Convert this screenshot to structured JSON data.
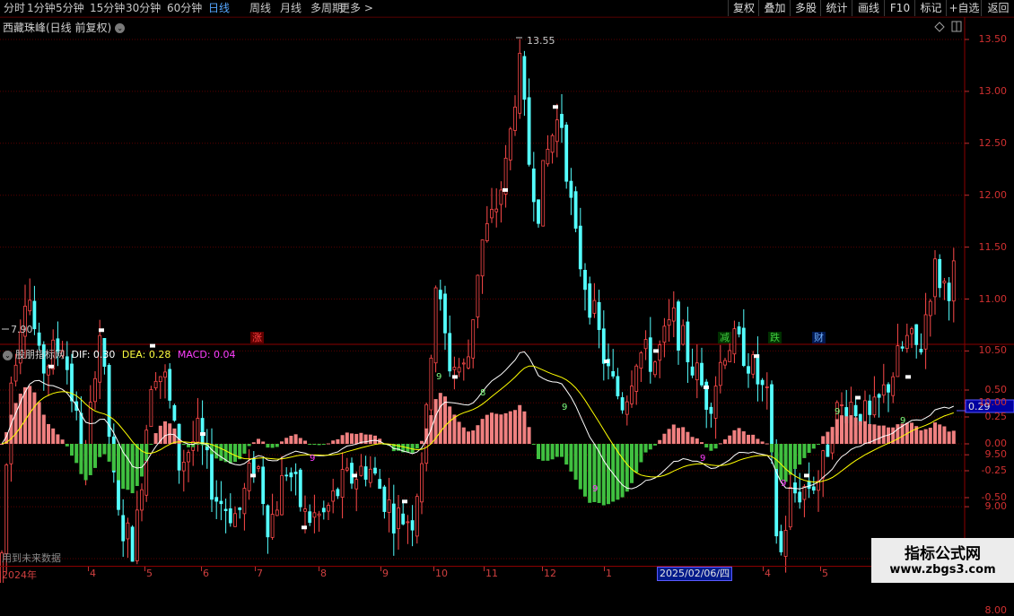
{
  "toolbar": {
    "periods": [
      "分时",
      "1分钟",
      "5分钟",
      "15分钟",
      "30分钟",
      "60分钟",
      "日线",
      "周线",
      "月线",
      "多周期",
      "更多 >"
    ],
    "active_period": "日线",
    "right_buttons": [
      "复权",
      "叠加",
      "多股",
      "统计",
      "画线",
      "F10",
      "标记",
      "+自选",
      "返回"
    ]
  },
  "chart": {
    "title": "西藏珠峰(日线 前复权)",
    "high_label": "13.55",
    "low_label": "7.90",
    "price_ticks": [
      "13.50",
      "13.00",
      "12.50",
      "12.00",
      "11.50",
      "11.00",
      "10.50",
      "10.00",
      "9.50",
      "9.00",
      "8.50",
      "8.00"
    ],
    "event_tags": [
      {
        "text": "涨",
        "color": "#ff4040",
        "bg": "#600000"
      },
      {
        "text": "减",
        "color": "#40d040",
        "bg": "#003000"
      },
      {
        "text": "跌",
        "color": "#40d040",
        "bg": "#003000"
      },
      {
        "text": "财",
        "color": "#70b0ff",
        "bg": "#001850"
      }
    ]
  },
  "indicator": {
    "name": "股朋指标网",
    "dif_label": "DIF: 0.30",
    "dea_label": "DEA: 0.28",
    "macd_label": "MACD: 0.04",
    "dif_color": "#ffffff",
    "dea_color": "#ffff00",
    "macd_color": "#ff40ff",
    "ticks": [
      "0.50",
      "0.25",
      "0.00",
      "-0.25",
      "-0.50"
    ],
    "current_value": "0.29",
    "note": "用到未来数据"
  },
  "date_axis": {
    "labels": [
      "2024年",
      "4",
      "5",
      "6",
      "7",
      "8",
      "9",
      "10",
      "11",
      "12",
      "1",
      "4",
      "5"
    ],
    "cursor_date": "2025/02/06/四"
  },
  "watermark": {
    "title": "指标公式网",
    "url": "www.zbgs3.com"
  },
  "chart_data": {
    "type": "candlestick",
    "price_axis_ticks": [
      8.0,
      8.5,
      9.0,
      9.5,
      10.0,
      10.5,
      11.0,
      11.5,
      12.0,
      12.5,
      13.0,
      13.5
    ],
    "high": 13.55,
    "low": 7.9,
    "indicator_axis_ticks": [
      -0.5,
      -0.25,
      0.0,
      0.25,
      0.5
    ],
    "last_indicator_value": 0.29
  }
}
